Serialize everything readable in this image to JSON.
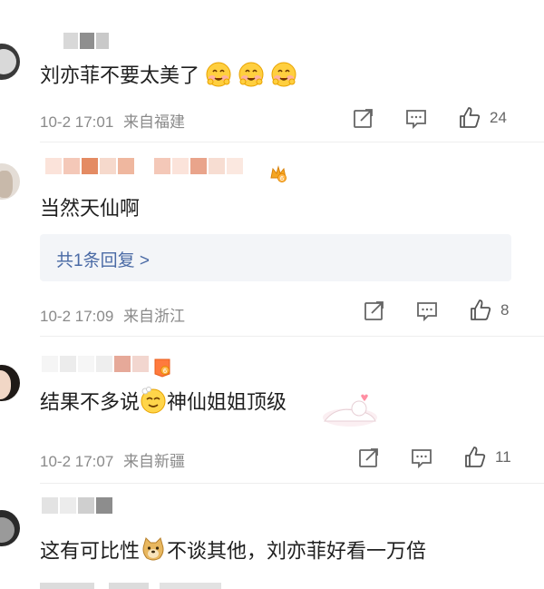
{
  "comments": [
    {
      "text": "刘亦菲不要太美了",
      "time": "10-2 17:01",
      "location": "来自福建",
      "likes": "24",
      "icons": [
        "share-icon",
        "comment-icon",
        "like-icon"
      ]
    },
    {
      "text": "当然天仙啊",
      "reply_summary": "共1条回复 >",
      "time": "10-2 17:09",
      "location": "来自浙江",
      "likes": "8"
    },
    {
      "text_before": "结果不多说",
      "text_after": "神仙姐姐顶级",
      "time": "10-2 17:07",
      "location": "来自新疆",
      "likes": "11"
    },
    {
      "text_before": "这有可比性",
      "text_after": "不谈其他，刘亦菲好看一万倍"
    }
  ],
  "colors": {
    "text": "#1f1f1f",
    "meta": "#8a8a8a",
    "link": "#4a6aa5",
    "reply_bg": "#f3f5f8"
  }
}
